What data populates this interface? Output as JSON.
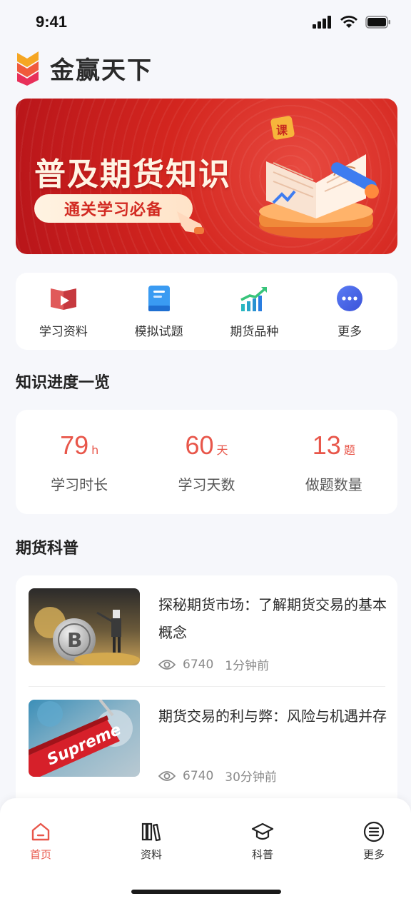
{
  "status_bar": {
    "time": "9:41"
  },
  "header": {
    "app_title": "金赢天下"
  },
  "banner": {
    "title": "普及期货知识",
    "pill_label": "通关学习必备",
    "badge": "课"
  },
  "quick_menu": [
    {
      "label": "学习资料",
      "icon": "book-play-icon"
    },
    {
      "label": "模拟试题",
      "icon": "notebook-icon"
    },
    {
      "label": "期货品种",
      "icon": "chart-up-icon"
    },
    {
      "label": "更多",
      "icon": "more-dots-icon"
    }
  ],
  "progress": {
    "section_title": "知识进度一览",
    "stats": [
      {
        "value": "79",
        "unit": "h",
        "label": "学习时长"
      },
      {
        "value": "60",
        "unit": "天",
        "label": "学习天数"
      },
      {
        "value": "13",
        "unit": "题",
        "label": "做题数量"
      }
    ]
  },
  "news": {
    "section_title": "期货科普",
    "items": [
      {
        "title": "探秘期货市场：了解期货交易的基本概念",
        "views": "6740",
        "time": "1分钟前"
      },
      {
        "title": "期货交易的利与弊：风险与机遇并存",
        "views": "6740",
        "time": "30分钟前"
      }
    ]
  },
  "tab_bar": {
    "tabs": [
      {
        "label": "首页",
        "icon": "home-icon",
        "active": true
      },
      {
        "label": "资料",
        "icon": "books-icon",
        "active": false
      },
      {
        "label": "科普",
        "icon": "graduation-cap-icon",
        "active": false
      },
      {
        "label": "更多",
        "icon": "menu-circle-icon",
        "active": false
      }
    ]
  },
  "colors": {
    "accent": "#e8564a",
    "banner_red": "#d4261f",
    "background": "#f6f7fb"
  }
}
